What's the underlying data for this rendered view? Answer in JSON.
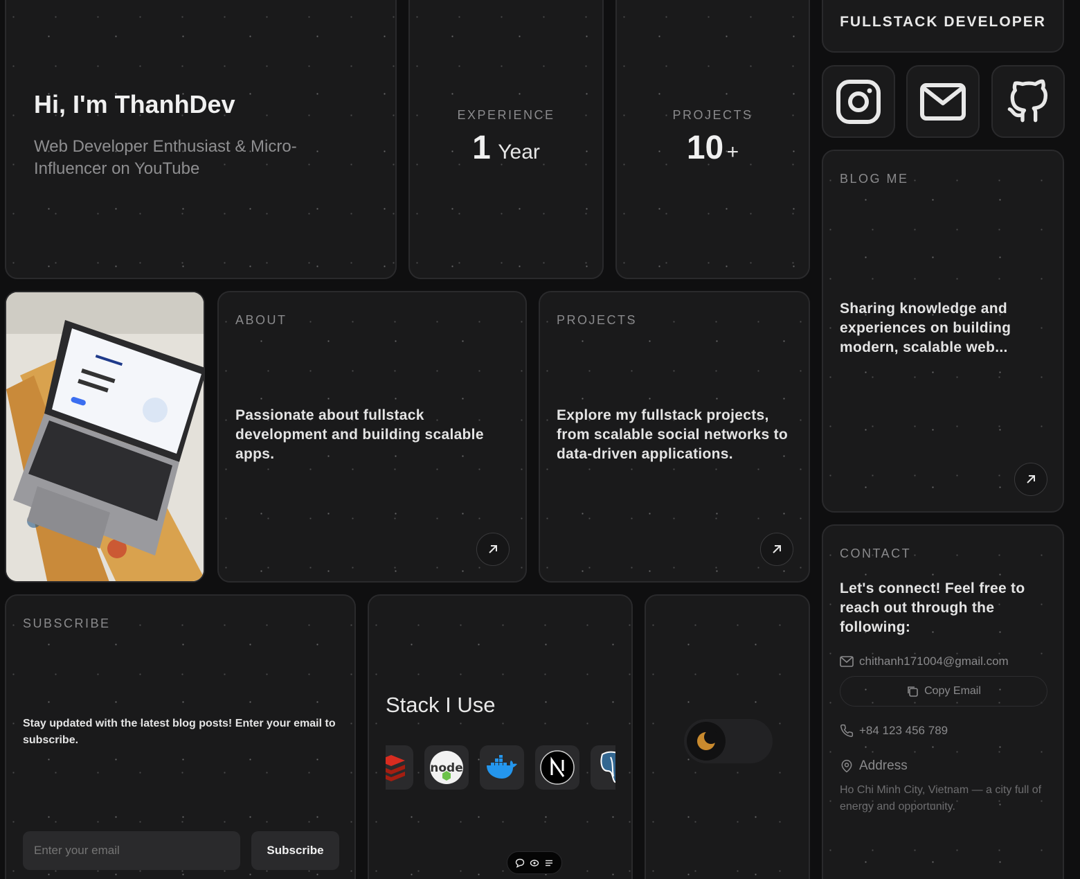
{
  "hero": {
    "title": "Hi, I'm ThanhDev",
    "subtitle": "Web Developer Enthusiast & Micro-Influencer on YouTube"
  },
  "experience": {
    "label": "EXPERIENCE",
    "value": "1",
    "unit": "Year"
  },
  "projects_stat": {
    "label": "PROJECTS",
    "value": "10",
    "unit": "+"
  },
  "role": {
    "title": "FULLSTACK DEVELOPER"
  },
  "social": {
    "icons": [
      "instagram-icon",
      "mail-icon",
      "github-icon"
    ]
  },
  "blog": {
    "label": "BLOG ME",
    "text": "Sharing knowledge and experiences on building modern, scalable web..."
  },
  "about": {
    "label": "ABOUT",
    "text": "Passionate about fullstack development and building scalable apps."
  },
  "projects": {
    "label": "PROJECTS",
    "text": "Explore my fullstack projects, from scalable social networks to data-driven applications."
  },
  "contact": {
    "label": "CONTACT",
    "text": "Let's connect! Feel free to reach out through the following:",
    "email": "chithanh171004@gmail.com",
    "copy_label": "Copy Email",
    "phone": "+84 123 456 789",
    "address_label": "Address",
    "address": "Ho Chi Minh City, Vietnam — a city full of energy and opportunity."
  },
  "subscribe": {
    "label": "SUBSCRIBE",
    "text": "Stay updated with the latest blog posts! Enter your email to subscribe.",
    "placeholder": "Enter your email",
    "button": "Subscribe"
  },
  "stack": {
    "title": "Stack I Use",
    "icons": [
      "redis-icon",
      "nodejs-icon",
      "docker-icon",
      "nextjs-icon",
      "postgresql-icon"
    ]
  },
  "theme": {
    "mode": "dark",
    "accent": "#c98a2e"
  }
}
